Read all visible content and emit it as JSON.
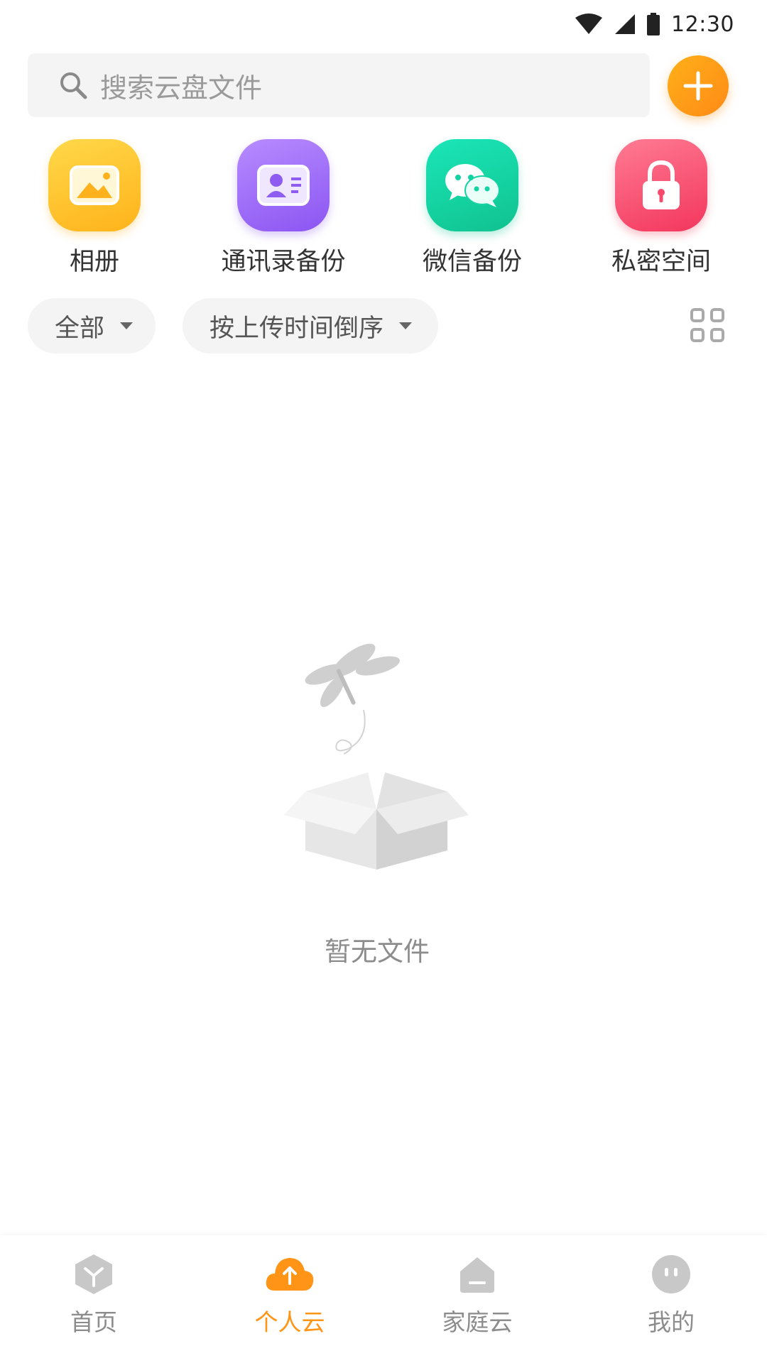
{
  "status_bar": {
    "time": "12:30"
  },
  "search": {
    "placeholder": "搜索云盘文件"
  },
  "quick_entries": [
    {
      "label": "相册",
      "icon": "photo-album-icon",
      "color": "#ffc22a"
    },
    {
      "label": "通讯录备份",
      "icon": "contacts-card-icon",
      "color": "#9d6cf6"
    },
    {
      "label": "微信备份",
      "icon": "wechat-icon",
      "color": "#14d3a2"
    },
    {
      "label": "私密空间",
      "icon": "lock-icon",
      "color": "#f7496b"
    }
  ],
  "filters": {
    "type_label": "全部",
    "sort_label": "按上传时间倒序"
  },
  "empty_state": {
    "message": "暂无文件"
  },
  "bottom_nav": [
    {
      "label": "首页",
      "icon": "home-cube-icon",
      "active": false
    },
    {
      "label": "个人云",
      "icon": "personal-cloud-upload-icon",
      "active": true
    },
    {
      "label": "家庭云",
      "icon": "family-cloud-house-icon",
      "active": false
    },
    {
      "label": "我的",
      "icon": "profile-face-icon",
      "active": false
    }
  ],
  "colors": {
    "accent": "#ff9416",
    "inactive": "#c8c8c8",
    "chip_bg": "#f4f4f4"
  }
}
